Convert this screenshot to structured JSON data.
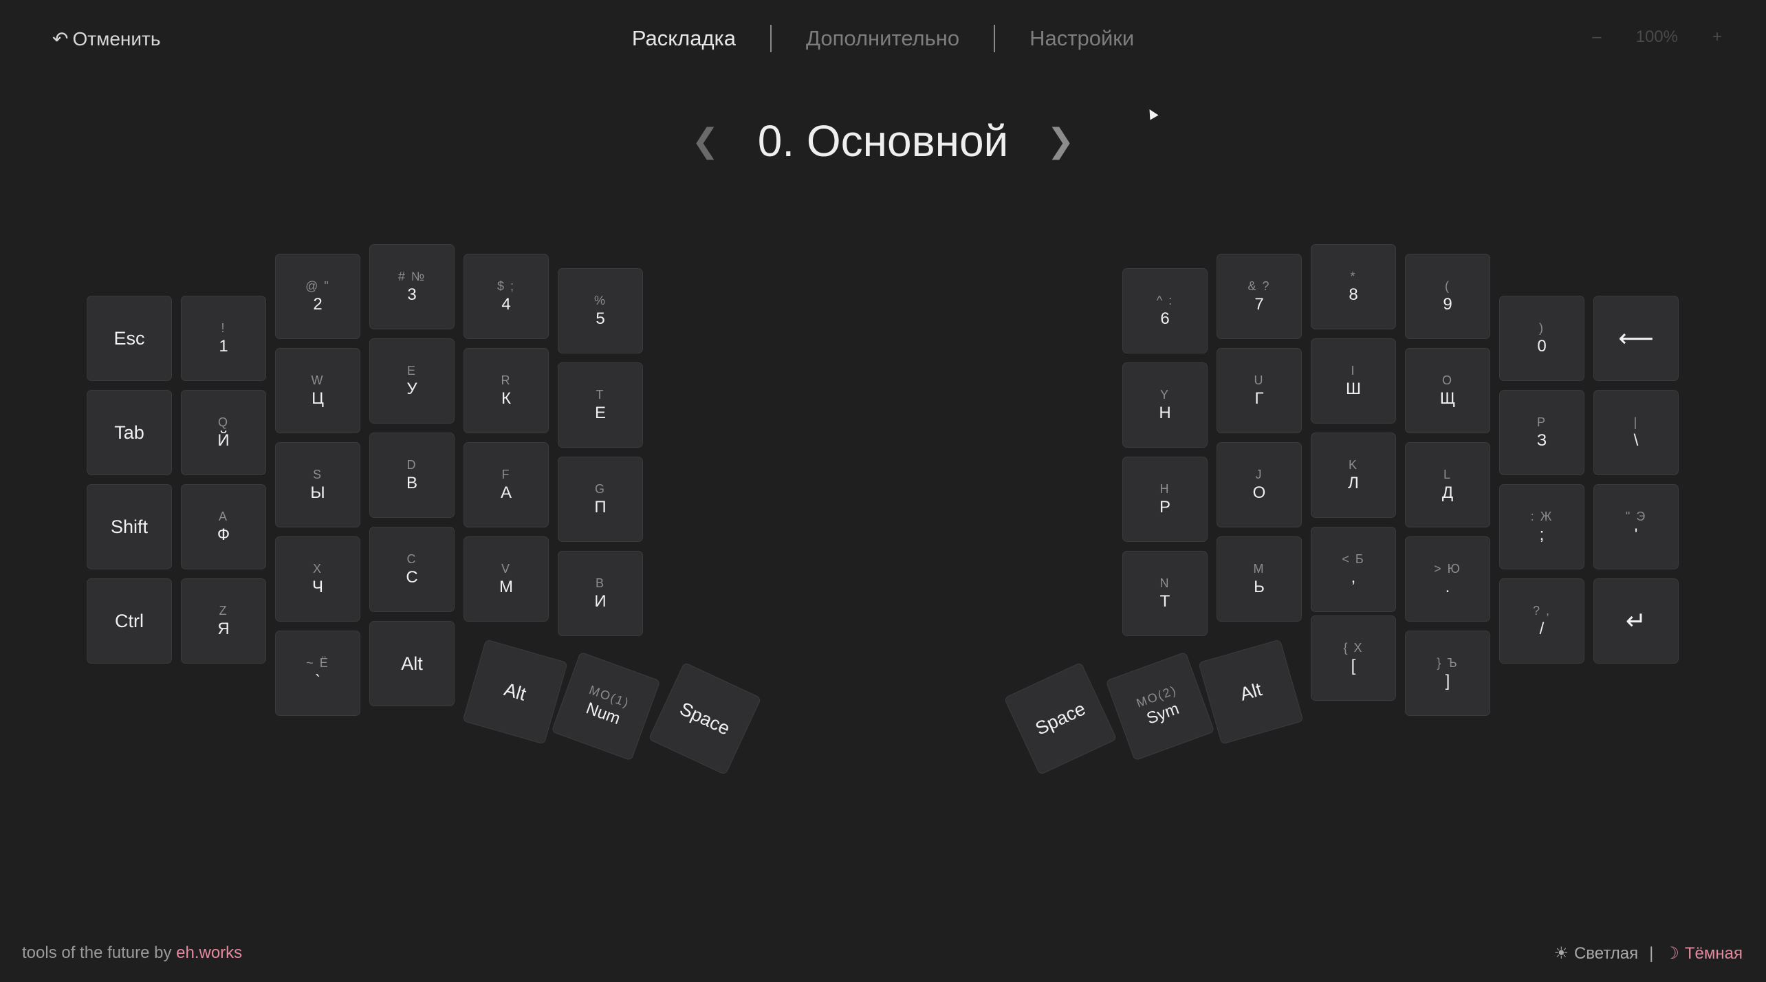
{
  "header": {
    "undo_icon": "↶",
    "undo_label": "Отменить",
    "tabs": [
      {
        "label": "Раскладка"
      },
      {
        "label": "Дополнительно"
      },
      {
        "label": "Настройки"
      }
    ],
    "zoom": {
      "minus": "–",
      "value": "100%",
      "plus": "+"
    }
  },
  "layer": {
    "prev_arrow": "❮",
    "title": "0. Основной",
    "next_arrow": "❯"
  },
  "keys": {
    "l_esc": {
      "p": "Esc"
    },
    "l_tab": {
      "p": "Tab"
    },
    "l_shift": {
      "p": "Shift"
    },
    "l_ctrl": {
      "p": "Ctrl"
    },
    "l_1": {
      "s": "!",
      "p": "1"
    },
    "l_q": {
      "s": "Q",
      "p": "Й"
    },
    "l_a": {
      "s": "A",
      "p": "Ф"
    },
    "l_z": {
      "s": "Z",
      "p": "Я"
    },
    "l_2": {
      "s": "@ \"",
      "p": "2"
    },
    "l_w": {
      "s": "W",
      "p": "Ц"
    },
    "l_s": {
      "s": "S",
      "p": "Ы"
    },
    "l_x": {
      "s": "X",
      "p": "Ч"
    },
    "l_grave": {
      "s": "~ Ё",
      "p": "`"
    },
    "l_3": {
      "s": "# №",
      "p": "3"
    },
    "l_e": {
      "s": "E",
      "p": "У"
    },
    "l_d": {
      "s": "D",
      "p": "В"
    },
    "l_c": {
      "s": "C",
      "p": "С"
    },
    "l_alt1": {
      "p": "Alt"
    },
    "l_4": {
      "s": "$ ;",
      "p": "4"
    },
    "l_r": {
      "s": "R",
      "p": "К"
    },
    "l_f": {
      "s": "F",
      "p": "А"
    },
    "l_v": {
      "s": "V",
      "p": "М"
    },
    "l_5": {
      "s": "%",
      "p": "5"
    },
    "l_t": {
      "s": "T",
      "p": "Е"
    },
    "l_g": {
      "s": "G",
      "p": "П"
    },
    "l_b": {
      "s": "B",
      "p": "И"
    },
    "l_alt2": {
      "p": "Alt"
    },
    "l_num": {
      "s": "MO(1)",
      "p": "Num"
    },
    "l_space": {
      "p": "Space"
    },
    "r_6": {
      "s": "^ :",
      "p": "6"
    },
    "r_y": {
      "s": "Y",
      "p": "Н"
    },
    "r_h": {
      "s": "H",
      "p": "Р"
    },
    "r_n": {
      "s": "N",
      "p": "Т"
    },
    "r_7": {
      "s": "& ?",
      "p": "7"
    },
    "r_u": {
      "s": "U",
      "p": "Г"
    },
    "r_j": {
      "s": "J",
      "p": "О"
    },
    "r_m": {
      "s": "M",
      "p": "Ь"
    },
    "r_8": {
      "s": "*",
      "p": "8"
    },
    "r_i": {
      "s": "I",
      "p": "Ш"
    },
    "r_k": {
      "s": "K",
      "p": "Л"
    },
    "r_comma": {
      "s": "< Б",
      "p": ","
    },
    "r_lbr": {
      "s": "{ Х",
      "p": "["
    },
    "r_9": {
      "s": "(",
      "p": "9"
    },
    "r_o": {
      "s": "O",
      "p": "Щ"
    },
    "r_l": {
      "s": "L",
      "p": "Д"
    },
    "r_dot": {
      "s": "> Ю",
      "p": "."
    },
    "r_rbr": {
      "s": "} Ъ",
      "p": "]"
    },
    "r_0": {
      "s": ")",
      "p": "0"
    },
    "r_p": {
      "s": "P",
      "p": "З"
    },
    "r_semi": {
      "s": ": Ж",
      "p": ";"
    },
    "r_slash": {
      "s": "? ,",
      "p": "/"
    },
    "r_bksp": {
      "p": "⟵"
    },
    "r_bslash": {
      "s": "|",
      "p": "\\"
    },
    "r_quote": {
      "s": "\" Э",
      "p": "'"
    },
    "r_enter": {
      "p": "↵"
    },
    "r_space": {
      "p": "Space"
    },
    "r_sym": {
      "s": "MO(2)",
      "p": "Sym"
    },
    "r_alt": {
      "p": "Alt"
    }
  },
  "footer": {
    "prefix": "tools of the future by ",
    "link": "eh.works",
    "light_icon": "☀",
    "light": "Светлая",
    "separator": "|",
    "dark_icon": "☽",
    "dark": "Тёмная"
  }
}
